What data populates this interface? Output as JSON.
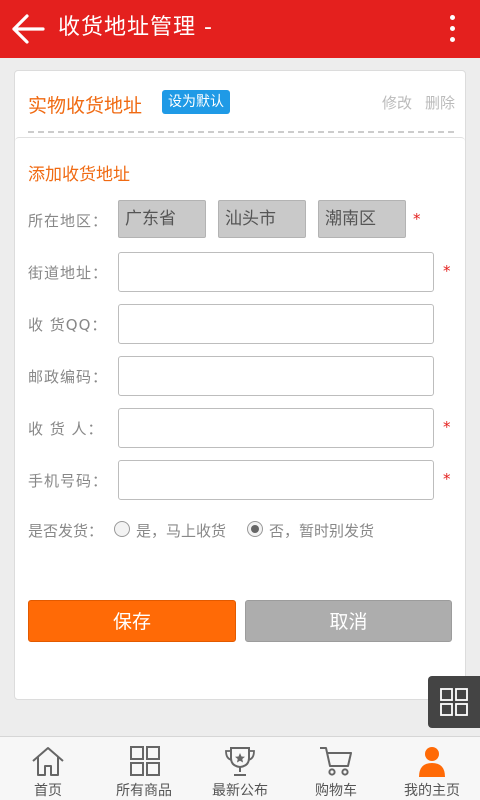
{
  "header": {
    "title": "收货地址管理 -"
  },
  "address_card": {
    "title": "实物收货地址",
    "default_badge": "设为默认",
    "edit": "修改",
    "delete": "删除"
  },
  "form": {
    "heading": "添加收货地址",
    "region": {
      "label": "所在地区：",
      "province": "广东省",
      "city": "汕头市",
      "district": "潮南区"
    },
    "street": {
      "label": "街道地址：",
      "value": ""
    },
    "qq": {
      "label": "收 货QQ：",
      "value": ""
    },
    "postcode": {
      "label": "邮政编码：",
      "value": ""
    },
    "receiver": {
      "label": "收 货 人：",
      "value": ""
    },
    "phone": {
      "label": "手机号码：",
      "value": ""
    },
    "required_mark": "*",
    "ship": {
      "label": "是否发货：",
      "option_yes": "是，马上收货",
      "option_no": "否，暂时别发货",
      "selected": "no"
    },
    "save": "保存",
    "cancel": "取消"
  },
  "nav": [
    {
      "label": "首页",
      "icon": "home-icon"
    },
    {
      "label": "所有商品",
      "icon": "grid-icon"
    },
    {
      "label": "最新公布",
      "icon": "trophy-icon"
    },
    {
      "label": "购物车",
      "icon": "cart-icon"
    },
    {
      "label": "我的主页",
      "icon": "user-icon"
    }
  ],
  "colors": {
    "header": "#e4201e",
    "accent": "#f06a12",
    "save": "#ff6a06",
    "badge": "#1f9ae6",
    "cancel": "#adadad"
  }
}
